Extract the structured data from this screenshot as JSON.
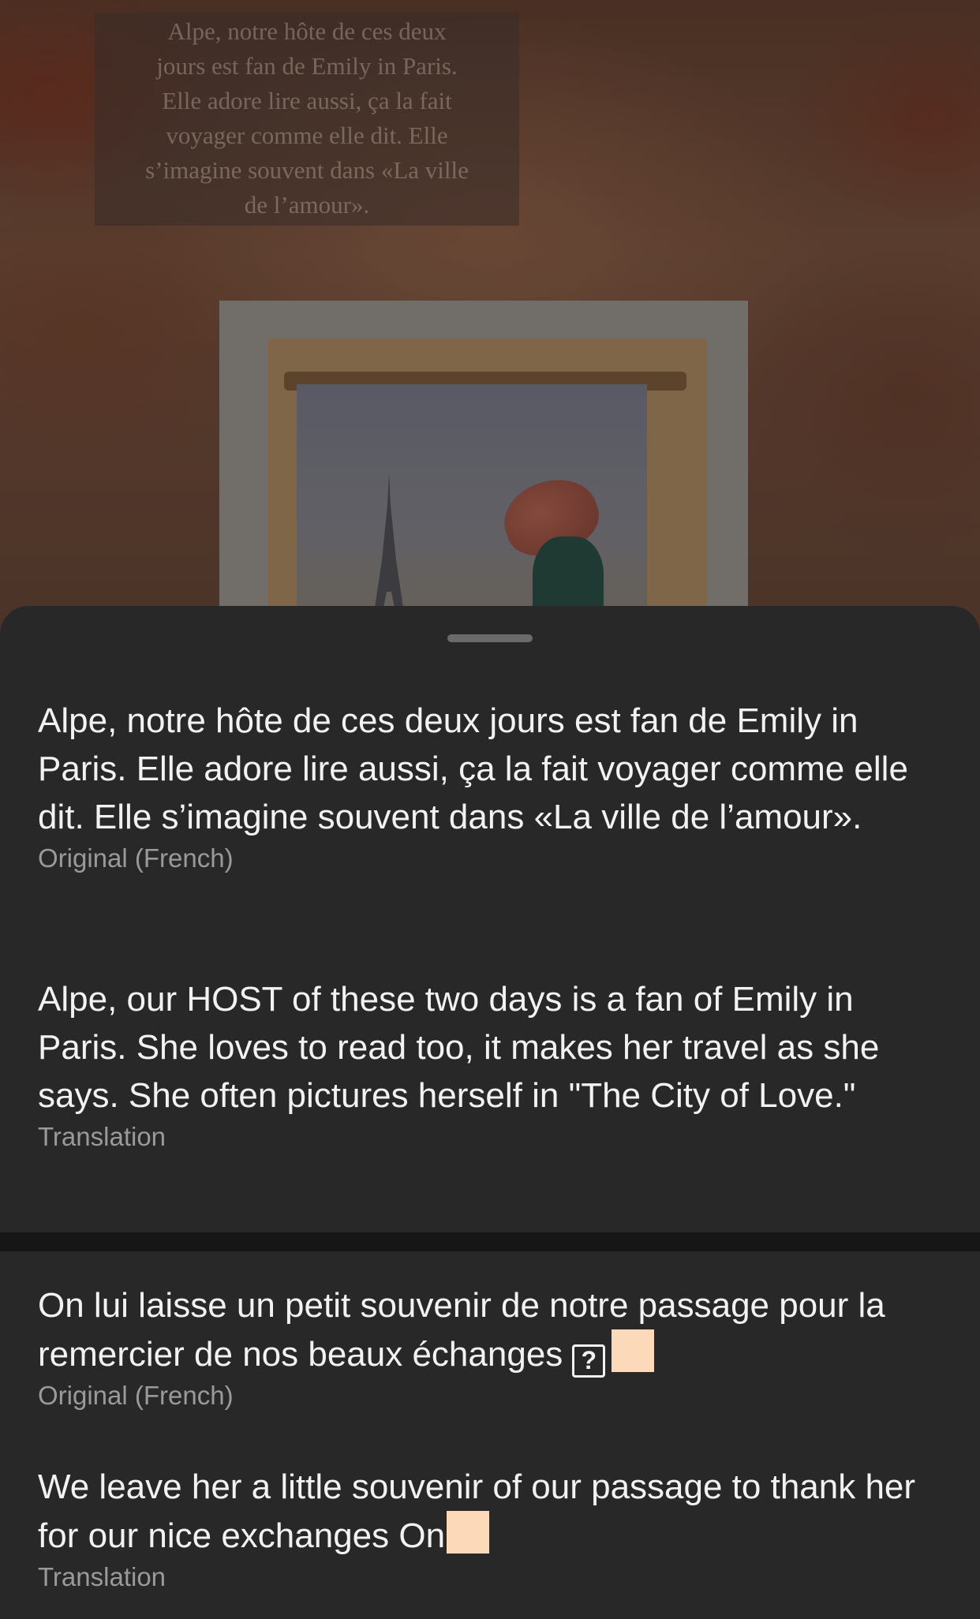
{
  "background": {
    "caption": "Alpe, notre hôte de ces deux\njours est fan de Emily in Paris.\nElle adore lire aussi, ça la fait\nvoyager comme elle dit. Elle\ns’imagine souvent dans «La ville\nde l’amour»."
  },
  "translations": [
    {
      "text": "Alpe, notre hôte de ces deux jours est fan de Emily in Paris. Elle adore lire aussi, ça la fait voyager comme elle dit. Elle s’imagine souvent dans «La ville de l’amour».",
      "label": "Original (French)"
    },
    {
      "text": "Alpe, our HOST of these two days is a fan of Emily in Paris. She loves to read too, it makes her travel as she says. She often pictures herself in \"The City of Love.\"",
      "label": "Translation"
    },
    {
      "text": "On lui laisse un petit souvenir de notre passage pour la remercier de nos beaux échanges",
      "qmark": "?",
      "label": "Original (French)"
    },
    {
      "text": "We leave her a little souvenir of our passage to thank her for our nice exchanges On",
      "label": "Translation"
    }
  ],
  "colors": {
    "sheet": "#282828",
    "text": "#f2f2f2",
    "label": "#9a9a9a",
    "emoji_skin": "#fcd9b8"
  }
}
